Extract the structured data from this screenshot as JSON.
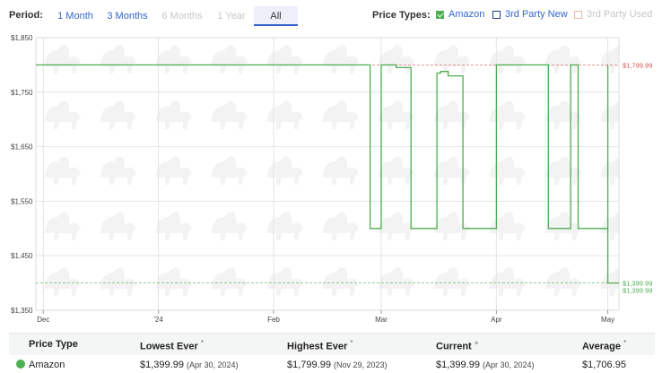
{
  "period": {
    "label": "Period:",
    "options": [
      {
        "label": "1 Month",
        "state": "enabled"
      },
      {
        "label": "3 Months",
        "state": "enabled"
      },
      {
        "label": "6 Months",
        "state": "disabled"
      },
      {
        "label": "1 Year",
        "state": "disabled"
      },
      {
        "label": "All",
        "state": "active"
      }
    ]
  },
  "price_types": {
    "label": "Price Types:",
    "options": [
      {
        "label": "Amazon",
        "checked": true,
        "color": "#4caf50"
      },
      {
        "label": "3rd Party New",
        "checked": false,
        "color": "#1f3f8f"
      },
      {
        "label": "3rd Party Used",
        "checked": false,
        "color": "#f0b9a8"
      }
    ]
  },
  "chart_data": {
    "type": "line",
    "ylim": [
      1350,
      1850
    ],
    "yticks": [
      1350,
      1450,
      1550,
      1650,
      1750,
      1850
    ],
    "ytick_labels": [
      "$1,350",
      "$1,450",
      "$1,550",
      "$1,650",
      "$1,750",
      "$1,850"
    ],
    "x_range": [
      "2023-11-29",
      "2024-05-04"
    ],
    "xticks": [
      {
        "date": "2023-12-01",
        "label": "Dec"
      },
      {
        "date": "2024-01-01",
        "label": "'24"
      },
      {
        "date": "2024-02-01",
        "label": "Feb"
      },
      {
        "date": "2024-03-01",
        "label": "Mar"
      },
      {
        "date": "2024-04-01",
        "label": "Apr"
      },
      {
        "date": "2024-05-01",
        "label": "May"
      }
    ],
    "grid": true,
    "series": [
      {
        "color": "#4caf50",
        "step": true,
        "points": [
          [
            "2023-11-29",
            1799.99
          ],
          [
            "2024-02-27",
            1499.99
          ],
          [
            "2024-03-01",
            1799.99
          ],
          [
            "2024-03-05",
            1794.99
          ],
          [
            "2024-03-09",
            1499.99
          ],
          [
            "2024-03-16",
            1784.99
          ],
          [
            "2024-03-17",
            1787.99
          ],
          [
            "2024-03-19",
            1779.99
          ],
          [
            "2024-03-23",
            1499.99
          ],
          [
            "2024-04-01",
            1799.99
          ],
          [
            "2024-04-15",
            1499.99
          ],
          [
            "2024-04-21",
            1799.99
          ],
          [
            "2024-04-23",
            1499.99
          ],
          [
            "2024-05-01",
            1799.99
          ],
          [
            "2024-05-01",
            1399.99
          ],
          [
            "2024-05-04",
            1399.99
          ]
        ]
      }
    ],
    "reference_lines": [
      {
        "value": 1799.99,
        "label": "$1,799.99",
        "color": "#d9534f"
      },
      {
        "value": 1399.99,
        "label": "$1,399.99",
        "color": "#4caf50"
      }
    ],
    "current_label": "$1,399.99"
  },
  "table": {
    "headers": [
      "Price Type",
      "Lowest Ever",
      "Highest Ever",
      "Current",
      "Average"
    ],
    "header_marks": [
      "",
      "*",
      "*",
      "+",
      "*"
    ],
    "row": {
      "type": "Amazon",
      "dot_color": "#4caf50",
      "lowest": "$1,399.99",
      "lowest_date": "(Apr 30, 2024)",
      "highest": "$1,799.99",
      "highest_date": "(Nov 29, 2023)",
      "current": "$1,399.99",
      "current_date": "(Apr 30, 2024)",
      "average": "$1,706.95"
    }
  }
}
